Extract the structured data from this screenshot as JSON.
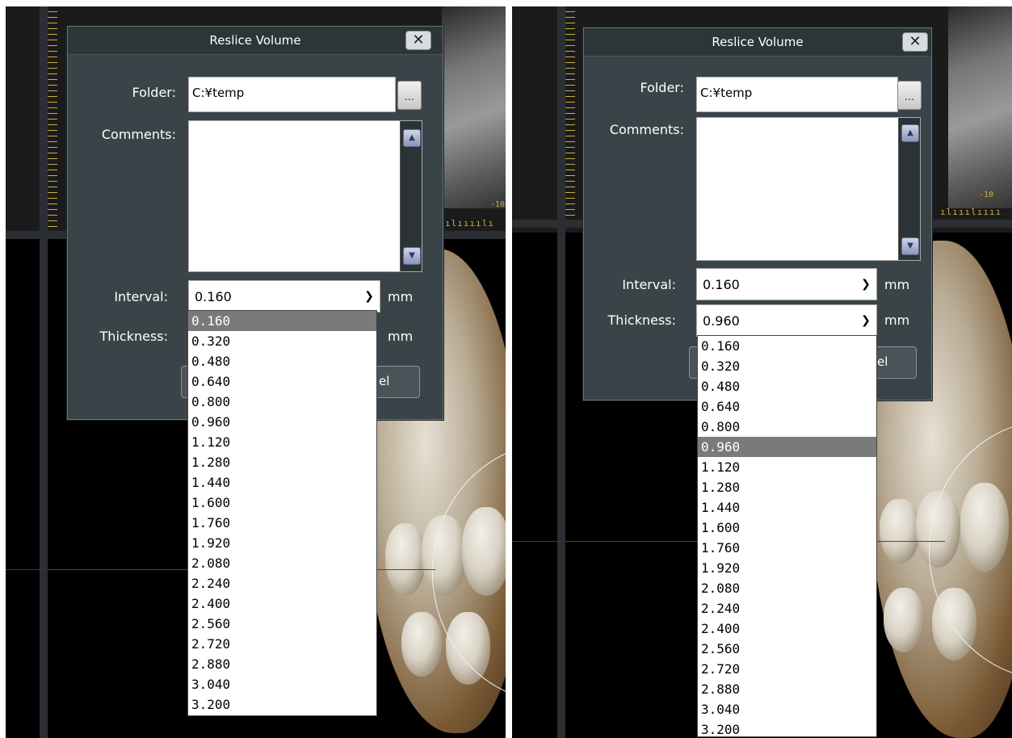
{
  "left": {
    "dialog": {
      "title": "Reslice Volume",
      "close_glyph": "✕",
      "folder_label": "Folder:",
      "folder_value": "C:¥temp",
      "browse_label": "...",
      "comments_label": "Comments:",
      "comments_value": "",
      "interval_label": "Interval:",
      "interval_value": "0.160",
      "thickness_label": "Thickness:",
      "thickness_value": "",
      "unit": "mm",
      "cancel_fragment": "el"
    },
    "dropdown": {
      "selected": "0.160",
      "options": [
        "0.160",
        "0.320",
        "0.480",
        "0.640",
        "0.800",
        "0.960",
        "1.120",
        "1.280",
        "1.440",
        "1.600",
        "1.760",
        "1.920",
        "2.080",
        "2.240",
        "2.400",
        "2.560",
        "2.720",
        "2.880",
        "3.040",
        "3.200"
      ]
    },
    "scale_label": "-10"
  },
  "right": {
    "dialog": {
      "title": "Reslice Volume",
      "close_glyph": "✕",
      "folder_label": "Folder:",
      "folder_value": "C:¥temp",
      "browse_label": "...",
      "comments_label": "Comments:",
      "comments_value": "",
      "interval_label": "Interval:",
      "interval_value": "0.160",
      "thickness_label": "Thickness:",
      "thickness_value": "0.960",
      "unit": "mm",
      "cancel_fragment": "el"
    },
    "dropdown": {
      "selected": "0.960",
      "options": [
        "0.160",
        "0.320",
        "0.480",
        "0.640",
        "0.800",
        "0.960",
        "1.120",
        "1.280",
        "1.440",
        "1.600",
        "1.760",
        "1.920",
        "2.080",
        "2.240",
        "2.400",
        "2.560",
        "2.720",
        "2.880",
        "3.040",
        "3.200"
      ]
    },
    "scale_label": "-10"
  },
  "colors": {
    "dialog_bg": "#3a4448",
    "selected_option": "#7a7a7a",
    "crosshair_red": "#d01010",
    "crosshair_blue": "#1030e0",
    "ruler": "#c8b040"
  },
  "icons": {
    "close": "close-icon",
    "dropdown": "chevron-down-icon",
    "scroll_up": "scroll-up-icon",
    "scroll_down": "scroll-down-icon"
  }
}
